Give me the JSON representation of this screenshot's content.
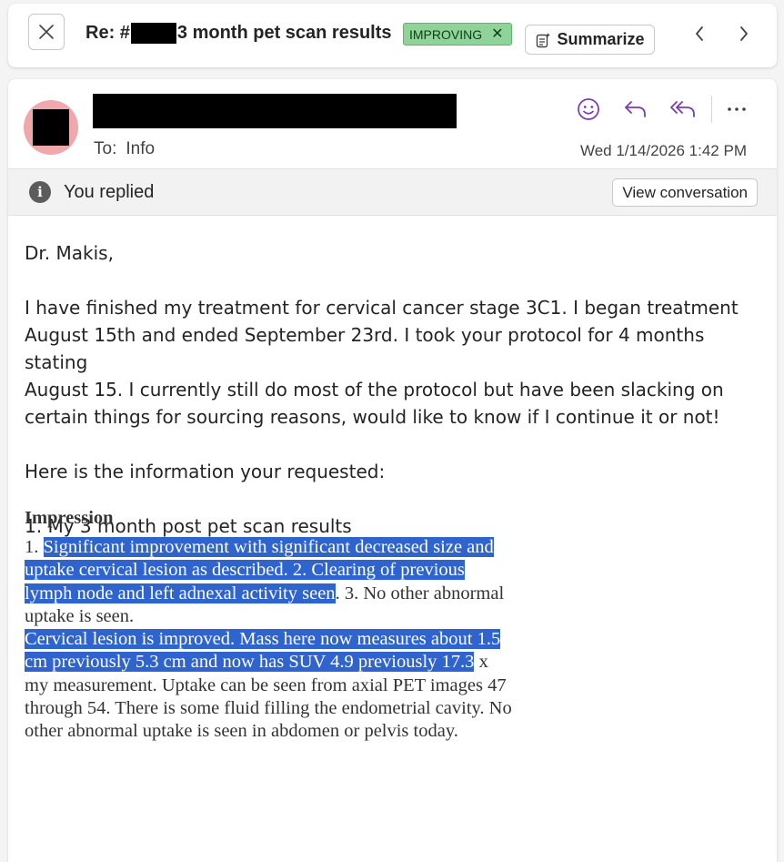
{
  "header": {
    "subject_prefix": "Re: #",
    "subject_suffix": "3 month pet scan results",
    "tag_label": "IMPROVING",
    "summarize_label": "Summarize"
  },
  "message": {
    "to_label": "To:",
    "to_value": "Info",
    "date": "Wed 1/14/2026 1:42 PM",
    "replied_notice": "You replied",
    "view_conversation_label": "View conversation"
  },
  "body": {
    "greeting": "Dr. Makis,",
    "para1_lines": [
      "I have finished my treatment for cervical cancer stage 3C1. I began treatment",
      "August 15th and ended September 23rd. I took your protocol for 4 months stating",
      "August 15. I currently still do most of the protocol but have been slacking on",
      "certain things for sourcing reasons, would like to know if I continue it or not!"
    ],
    "para2": "Here is the information your requested:",
    "list_item": "1. My 3 month post pet scan results"
  },
  "impression": {
    "heading": "Impression",
    "l1_pre": "1. ",
    "l1_hl": "Significant improvement with significant decreased size and",
    "l2_hl": "uptake cervical lesion as described. 2. Clearing of previous",
    "l3_hl": "lymph node and left adnexal activity seen",
    "l3_post": ". 3. No other abnormal",
    "l4": "uptake is seen.",
    "l5_hl": "Cervical lesion is improved. Mass here now measures about 1.5",
    "l6_hl": "cm previously 5.3 cm and now has SUV 4.9 previously 17.3",
    "l6_post": " x",
    "l7": "my measurement. Uptake can be seen from axial PET images 47",
    "l8": "through 54. There is some fluid filling the endometrial cavity. No",
    "l9": "other abnormal uptake is seen in abdomen or pelvis today."
  },
  "icons": {
    "close": "close-icon",
    "tag_remove": "close-icon",
    "summarize": "summarize-icon",
    "prev": "chevron-left-icon",
    "next": "chevron-right-icon",
    "emoji": "smiley-icon",
    "reply": "reply-icon",
    "reply_all": "reply-all-icon",
    "more": "more-icon",
    "info": "info-icon"
  },
  "colors": {
    "tag_bg": "#8fd39a",
    "action_purple": "#7a3bb5",
    "highlight": "#2f64cf",
    "avatar_bg": "#f0a8ac"
  }
}
